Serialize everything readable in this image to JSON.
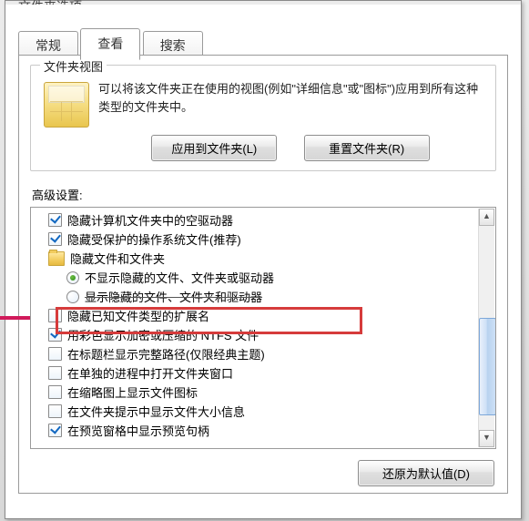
{
  "window": {
    "title_fragment": "文件夹选项"
  },
  "tabs": {
    "general": "常规",
    "view": "查看",
    "search": "搜索"
  },
  "folder_views": {
    "group_title": "文件夹视图",
    "description": "可以将该文件夹正在使用的视图(例如\"详细信息\"或\"图标\")应用到所有这种类型的文件夹中。",
    "apply_btn": "应用到文件夹(L)",
    "reset_btn": "重置文件夹(R)"
  },
  "advanced": {
    "label": "高级设置:",
    "items": [
      {
        "kind": "checkbox",
        "indent": 1,
        "checked": true,
        "text": "隐藏计算机文件夹中的空驱动器"
      },
      {
        "kind": "checkbox",
        "indent": 1,
        "checked": true,
        "text": "隐藏受保护的操作系统文件(推荐)"
      },
      {
        "kind": "folder",
        "indent": 1,
        "text": "隐藏文件和文件夹"
      },
      {
        "kind": "radio",
        "indent": 2,
        "selected": true,
        "text": "不显示隐藏的文件、文件夹或驱动器"
      },
      {
        "kind": "radio",
        "indent": 2,
        "selected": false,
        "strike": true,
        "text": "显示隐藏的文件、文件夹和驱动器"
      },
      {
        "kind": "checkbox",
        "indent": 1,
        "checked": false,
        "highlight": true,
        "text": "隐藏已知文件类型的扩展名"
      },
      {
        "kind": "checkbox",
        "indent": 1,
        "checked": true,
        "text": "用彩色显示加密或压缩的 NTFS 文件"
      },
      {
        "kind": "checkbox",
        "indent": 1,
        "checked": false,
        "text": "在标题栏显示完整路径(仅限经典主题)"
      },
      {
        "kind": "checkbox",
        "indent": 1,
        "checked": false,
        "text": "在单独的进程中打开文件夹窗口"
      },
      {
        "kind": "checkbox",
        "indent": 1,
        "checked": false,
        "text": "在缩略图上显示文件图标"
      },
      {
        "kind": "checkbox",
        "indent": 1,
        "checked": false,
        "text": "在文件夹提示中显示文件大小信息"
      },
      {
        "kind": "checkbox",
        "indent": 1,
        "checked": true,
        "text": "在预览窗格中显示预览句柄"
      }
    ]
  },
  "restore_defaults_btn": "还原为默认值(D)",
  "colors": {
    "highlight": "#d63b3b",
    "arrow": "#d11a5b"
  }
}
